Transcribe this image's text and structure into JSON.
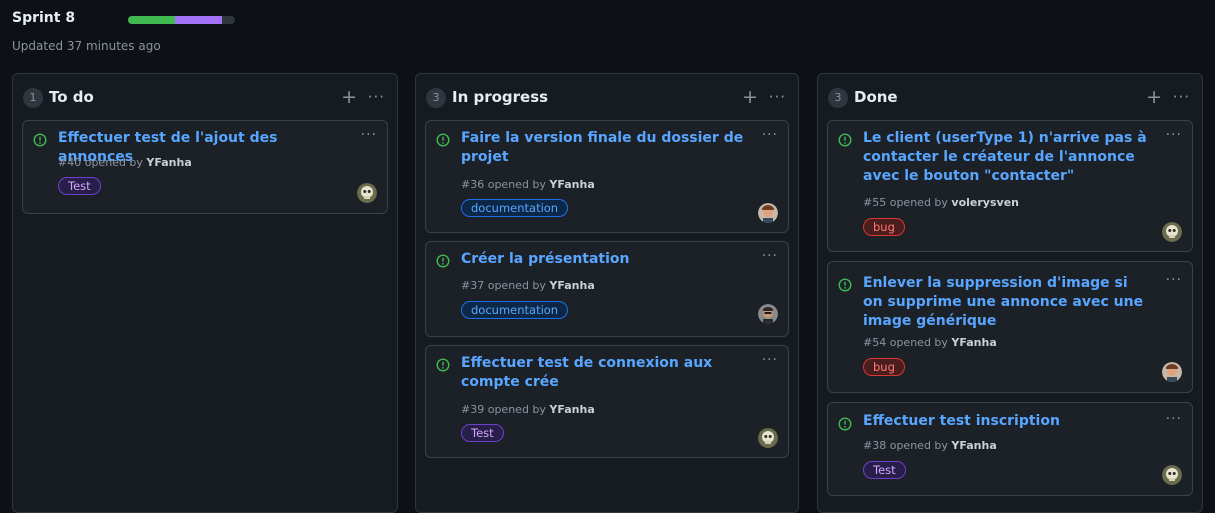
{
  "header": {
    "sprint_title": "Sprint 8",
    "updated": "Updated 37 minutes ago",
    "progress": {
      "done_fraction": 0.44,
      "in_progress_fraction": 0.44,
      "done_color": "#3fb950",
      "in_progress_color": "#a371f7"
    }
  },
  "columns": [
    {
      "count": "1",
      "name": "To do",
      "add_icon": "plus-icon",
      "more_icon": "ellipsis-icon",
      "cards": [
        {
          "title": "Effectuer test de l'ajout des annonces",
          "number": "#40",
          "opened_by": "opened by",
          "author": "YFanha",
          "label": "Test"
        }
      ]
    },
    {
      "count": "3",
      "name": "In progress",
      "add_icon": "plus-icon",
      "more_icon": "ellipsis-icon",
      "cards": [
        {
          "title": "Faire la version finale du dossier de projet",
          "number": "#36",
          "opened_by": "opened by",
          "author": "YFanha",
          "label": "documentation"
        },
        {
          "title": "Créer la présentation",
          "number": "#37",
          "opened_by": "opened by",
          "author": "YFanha",
          "label": "documentation"
        },
        {
          "title": "Effectuer test de connexion aux compte crée",
          "number": "#39",
          "opened_by": "opened by",
          "author": "YFanha",
          "label": "Test"
        }
      ]
    },
    {
      "count": "3",
      "name": "Done",
      "add_icon": "plus-icon",
      "more_icon": "ellipsis-icon",
      "cards": [
        {
          "title": "Le client (userType 1) n'arrive pas à contacter le créateur de l'annonce avec le bouton \"contacter\"",
          "number": "#55",
          "opened_by": "opened by",
          "author": "volerysven",
          "label": "bug"
        },
        {
          "title": "Enlever la suppression d'image si on supprime une annonce avec une image générique",
          "number": "#54",
          "opened_by": "opened by",
          "author": "YFanha",
          "label": "bug"
        },
        {
          "title": "Effectuer test inscription",
          "number": "#38",
          "opened_by": "opened by",
          "author": "YFanha",
          "label": "Test"
        }
      ]
    }
  ],
  "labels": {
    "Test": {
      "color": "#d2a8ff",
      "bg": "#271e4a",
      "border": "#6e40c9"
    },
    "documentation": {
      "color": "#58a6ff",
      "bg": "#0d2847",
      "border": "#1f6feb"
    },
    "bug": {
      "color": "#ff7b72",
      "bg": "#4a1d1f",
      "border": "#da3633"
    }
  },
  "issue_icon_color": "#3fb950"
}
